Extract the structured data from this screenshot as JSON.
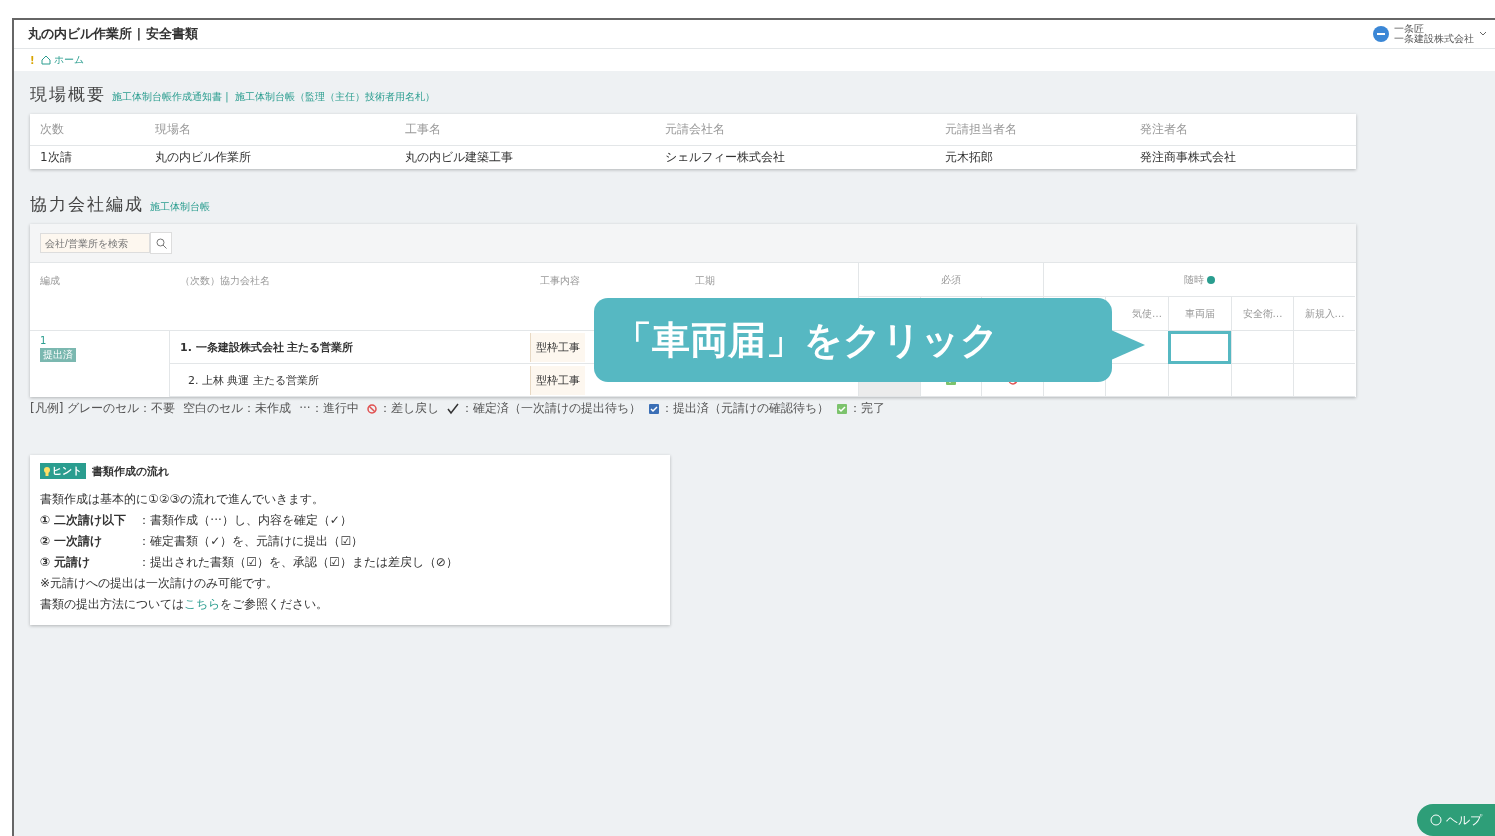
{
  "header": {
    "title": "丸の内ビル作業所 | 安全書類",
    "user": {
      "name": "一条匠",
      "company": "一条建設株式会社"
    }
  },
  "breadcrumb": {
    "marker": "!",
    "home": "ホーム"
  },
  "overview": {
    "title": "現場概要",
    "links": [
      "施工体制台帳作成通知書 |",
      "施工体制台帳（監理（主任）技術者用名札）"
    ],
    "columns": [
      "次数",
      "現場名",
      "工事名",
      "元請会社名",
      "元請担当者名",
      "発注者名"
    ],
    "values": [
      "1次請",
      "丸の内ビル作業所",
      "丸の内ビル建築工事",
      "シェルフィー株式会社",
      "元木拓郎",
      "発注商事株式会社"
    ]
  },
  "partners": {
    "title": "協力会社編成",
    "links": [
      "施工体制台帳"
    ],
    "search": {
      "placeholder": "会社/営業所を検索"
    },
    "columns": [
      "編成",
      "（次数）協力会社名",
      "工事内容",
      "工期",
      "必須",
      "随時"
    ],
    "anytime_headers": [
      "気使…",
      "車両届",
      "安全衛…",
      "新規入…"
    ],
    "rows": [
      {
        "group": "1",
        "badge": "提出済",
        "company": "1. 一条建設株式会社 主たる営業所",
        "work": "型枠工事",
        "emphasis": true,
        "required": [],
        "anytime": [
          {
            "highlighted": true
          },
          {
            "highlighted": false
          },
          {
            "highlighted": false
          }
        ]
      },
      {
        "company": "2. 上林 典運 主たる営業所",
        "work": "型枠工事",
        "emphasis": false,
        "required": [
          {
            "kind": "grey"
          },
          {
            "kind": "complete"
          },
          {
            "kind": "rejected"
          }
        ],
        "anytime": [
          {
            "highlighted": false
          },
          {
            "highlighted": false
          },
          {
            "highlighted": false
          },
          {
            "highlighted": false
          },
          {
            "highlighted": false
          }
        ]
      }
    ],
    "callout": "「車両届」をクリック",
    "legend": [
      {
        "kind": "text",
        "label": "[凡例] グレーのセル：不要"
      },
      {
        "kind": "text",
        "label": "空白のセル：未作成"
      },
      {
        "kind": "text",
        "label": "···：進行中"
      },
      {
        "kind": "rejected",
        "label": "：差し戻し"
      },
      {
        "kind": "check",
        "label": "：確定済（一次請けの提出待ち）"
      },
      {
        "kind": "submitted",
        "label": "：提出済（元請けの確認待ち）"
      },
      {
        "kind": "complete",
        "label": "：完了"
      }
    ]
  },
  "hint": {
    "badge": "ヒント",
    "title": "書類作成の流れ",
    "lines": [
      "書類作成は基本的に①②③の流れで進んでいきます。",
      "**① 二次請け以下**　：書類作成（···）し、内容を確定（✓）",
      "**② 一次請け**　　　：確定書類（✓）を、元請けに提出（☑）",
      "**③ 元請け**　　　　：提出された書類（☑）を、承認（☑）または差戻し（⊘）",
      "※元請けへの提出は一次請けのみ可能です。"
    ],
    "link_line": {
      "before": "書類の提出方法については",
      "link": "こちら",
      "after": "をご参照ください。"
    }
  },
  "help": {
    "label": "ヘルプ"
  }
}
